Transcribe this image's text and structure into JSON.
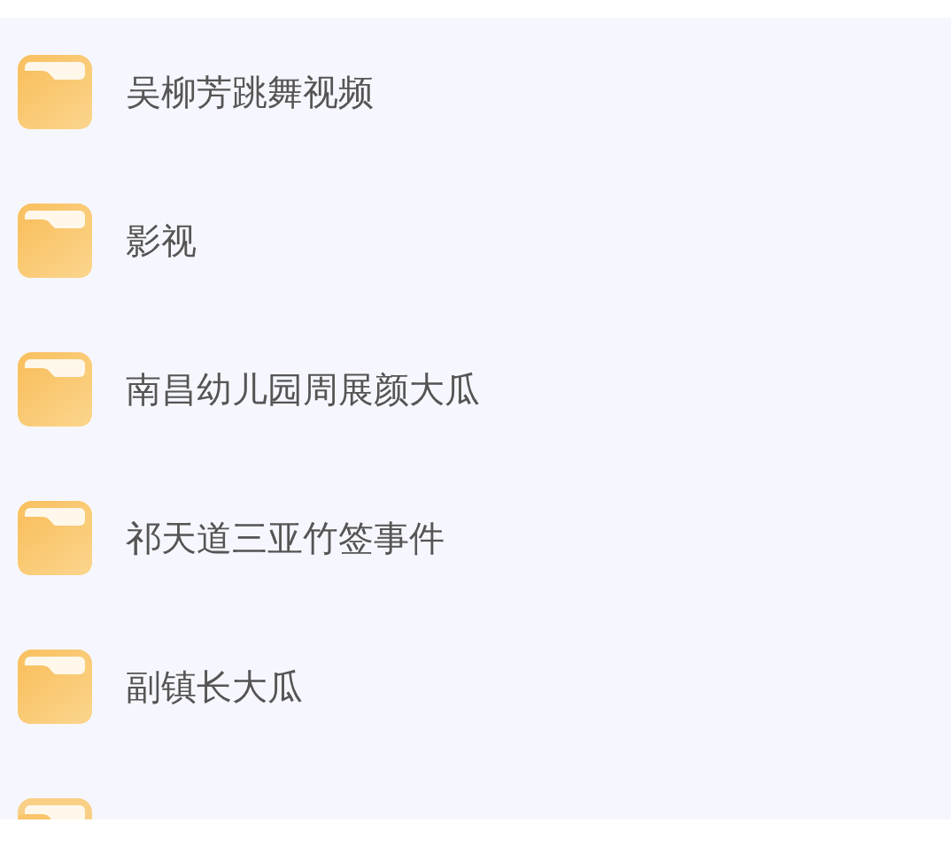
{
  "folders": [
    {
      "name": "吴柳芳跳舞视频"
    },
    {
      "name": "影视"
    },
    {
      "name": "南昌幼儿园周展颜大瓜"
    },
    {
      "name": "祁天道三亚竹签事件"
    },
    {
      "name": "副镇长大瓜"
    }
  ],
  "cut_folder_below": true
}
